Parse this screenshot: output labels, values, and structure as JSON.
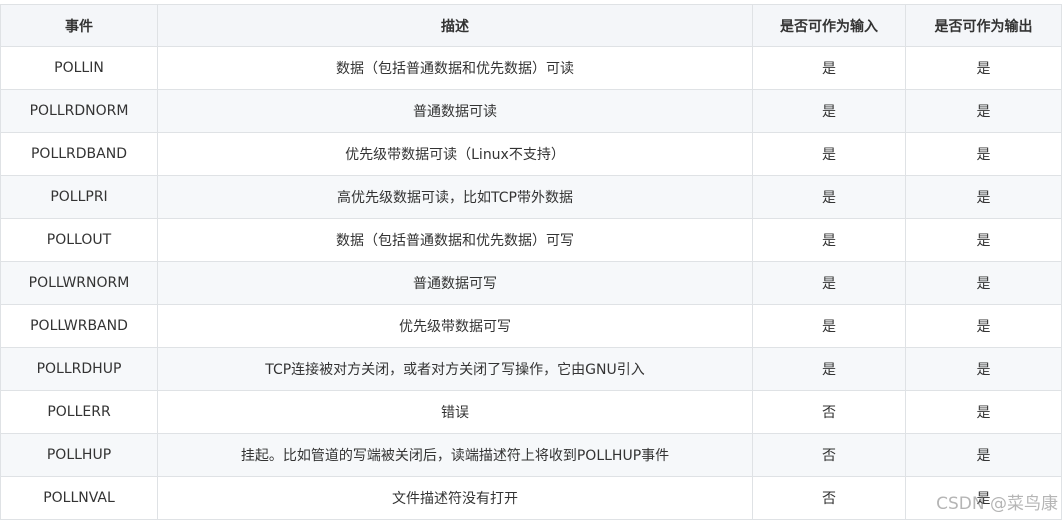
{
  "table": {
    "headers": [
      "事件",
      "描述",
      "是否可作为输入",
      "是否可作为输出"
    ],
    "rows": [
      [
        "POLLIN",
        "数据（包括普通数据和优先数据）可读",
        "是",
        "是"
      ],
      [
        "POLLRDNORM",
        "普通数据可读",
        "是",
        "是"
      ],
      [
        "POLLRDBAND",
        "优先级带数据可读（Linux不支持）",
        "是",
        "是"
      ],
      [
        "POLLPRI",
        "高优先级数据可读，比如TCP带外数据",
        "是",
        "是"
      ],
      [
        "POLLOUT",
        "数据（包括普通数据和优先数据）可写",
        "是",
        "是"
      ],
      [
        "POLLWRNORM",
        "普通数据可写",
        "是",
        "是"
      ],
      [
        "POLLWRBAND",
        "优先级带数据可写",
        "是",
        "是"
      ],
      [
        "POLLRDHUP",
        "TCP连接被对方关闭，或者对方关闭了写操作，它由GNU引入",
        "是",
        "是"
      ],
      [
        "POLLERR",
        "错误",
        "否",
        "是"
      ],
      [
        "POLLHUP",
        "挂起。比如管道的写端被关闭后，读端描述符上将收到POLLHUP事件",
        "否",
        "是"
      ],
      [
        "POLLNVAL",
        "文件描述符没有打开",
        "否",
        "是"
      ]
    ]
  },
  "watermark": "CSDN @菜鸟康"
}
